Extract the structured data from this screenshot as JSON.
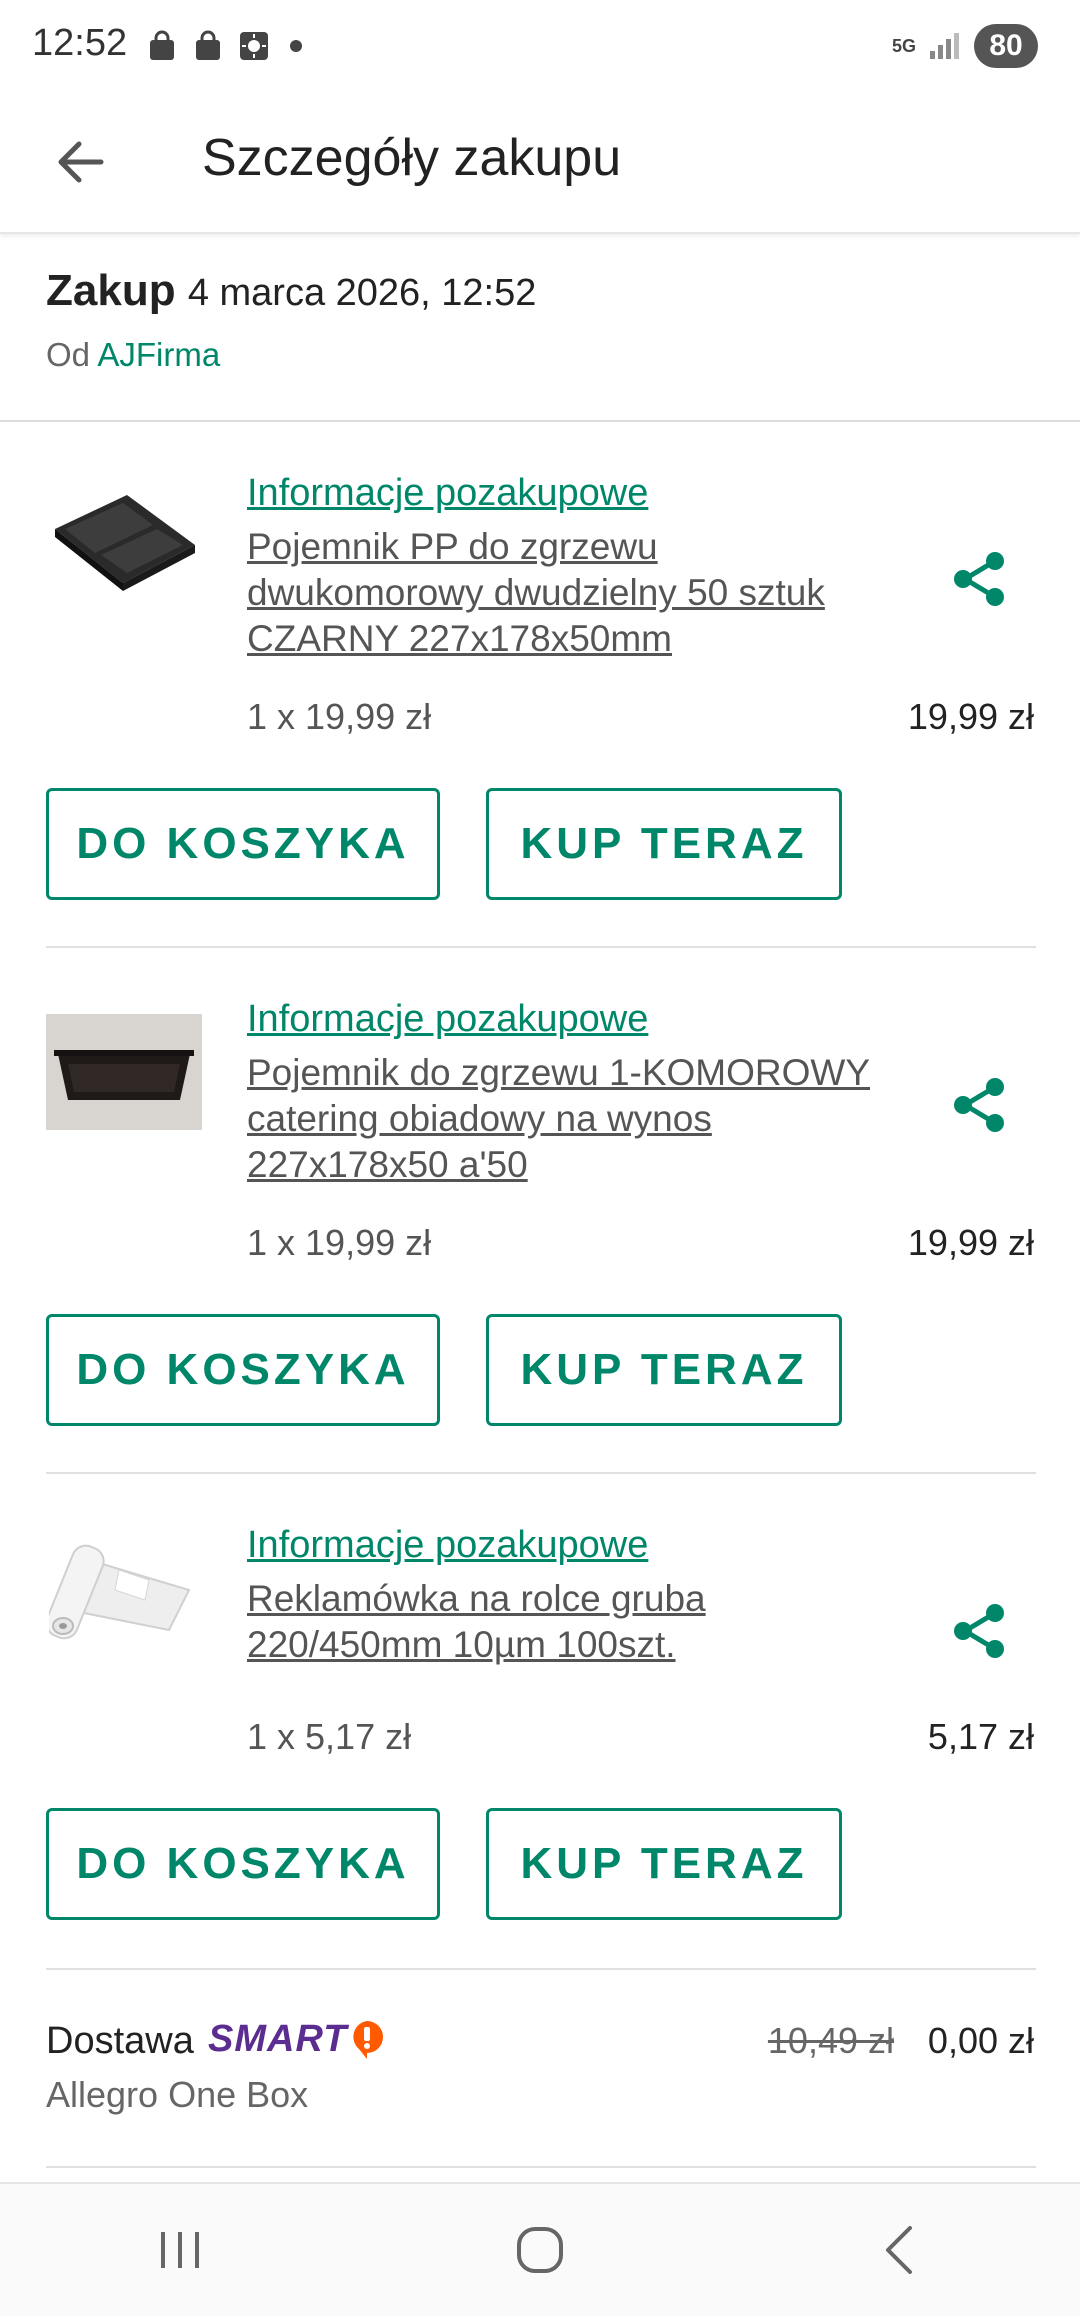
{
  "status": {
    "time": "12:52",
    "network": "5G",
    "battery": "80"
  },
  "header": {
    "title": "Szczegóły zakupu"
  },
  "purchase": {
    "label": "Zakup",
    "date": "4 marca 2026, 12:52",
    "from_label": "Od",
    "seller": "AJFirma"
  },
  "items": [
    {
      "info_link": "Informacje pozakupowe",
      "title": "Pojemnik PP do zgrzewu dwukomorowy dwudzielny 50 sztuk CZARNY 227x178x50mm",
      "qty": "1 x 19,99 zł",
      "price": "19,99 zł",
      "cart_label": "DO KOSZYKA",
      "buy_label": "KUP TERAZ",
      "thumb_icon": "two-compartment-container-image"
    },
    {
      "info_link": "Informacje pozakupowe",
      "title": "Pojemnik do zgrzewu 1-KOMOROWY catering obiadowy na wynos 227x178x50 a'50",
      "qty": "1 x 19,99 zł",
      "price": "19,99 zł",
      "cart_label": "DO KOSZYKA",
      "buy_label": "KUP TERAZ",
      "thumb_icon": "single-compartment-container-image"
    },
    {
      "info_link": "Informacje pozakupowe",
      "title": "Reklamówka na rolce gruba 220/450mm 10µm 100szt.",
      "qty": "1 x 5,17 zł",
      "price": "5,17 zł",
      "cart_label": "DO KOSZYKA",
      "buy_label": "KUP TERAZ",
      "thumb_icon": "plastic-bag-roll-image"
    }
  ],
  "delivery": {
    "label": "Dostawa",
    "badge": "SMART",
    "method": "Allegro One Box",
    "old_price": "10,49 zł",
    "new_price": "0,00 zł"
  },
  "colors": {
    "accent": "#00876a",
    "smart": "#5c2d91",
    "smart_mark": "#ff5a00"
  }
}
